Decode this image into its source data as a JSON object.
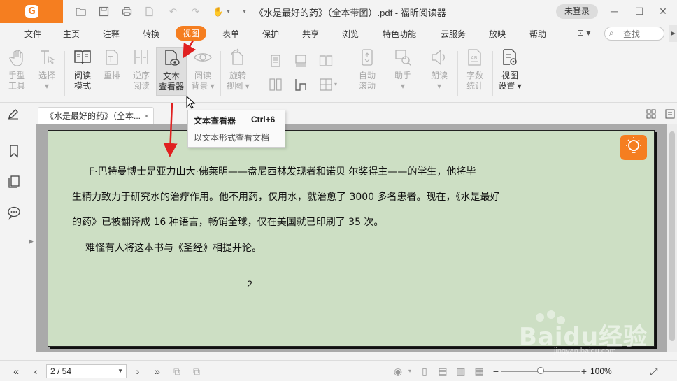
{
  "window": {
    "title": "《水是最好的药》（全本带图）.pdf - 福昕阅读器",
    "login_label": "未登录",
    "accent_color": "#f57e20"
  },
  "menu": {
    "items": [
      "文件",
      "主页",
      "注释",
      "转换",
      "视图",
      "表单",
      "保护",
      "共享",
      "浏览",
      "特色功能",
      "云服务",
      "放映",
      "帮助"
    ],
    "active": "视图",
    "search_placeholder": "查找"
  },
  "ribbon": {
    "tools": [
      {
        "line1": "手型",
        "line2": "工具",
        "state": "disabled",
        "icon": "hand-icon"
      },
      {
        "line1": "选择",
        "line2": "▾",
        "state": "disabled",
        "icon": "select-text-icon"
      },
      {
        "line1": "阅读",
        "line2": "模式",
        "state": "enabled",
        "icon": "book-icon"
      },
      {
        "line1": "重排",
        "line2": "",
        "state": "disabled",
        "icon": "reflow-icon"
      },
      {
        "line1": "逆序",
        "line2": "阅读",
        "state": "disabled",
        "icon": "reverse-icon"
      },
      {
        "line1": "文本",
        "line2": "查看器",
        "state": "selected",
        "icon": "text-viewer-icon"
      },
      {
        "line1": "阅读",
        "line2": "背景 ▾",
        "state": "disabled",
        "icon": "eye-icon"
      },
      {
        "line1": "旋转",
        "line2": "视图 ▾",
        "state": "disabled",
        "icon": "rotate-icon"
      },
      {
        "line1": "自动",
        "line2": "滚动",
        "state": "disabled",
        "icon": "auto-scroll-icon"
      },
      {
        "line1": "助手",
        "line2": "▾",
        "state": "disabled",
        "icon": "assistant-icon"
      },
      {
        "line1": "朗读",
        "line2": "▾",
        "state": "disabled",
        "icon": "speaker-icon"
      },
      {
        "line1": "字数",
        "line2": "统计",
        "state": "disabled",
        "icon": "word-count-icon"
      },
      {
        "line1": "视图",
        "line2": "设置 ▾",
        "state": "enabled",
        "icon": "view-settings-icon"
      }
    ]
  },
  "tab": {
    "title": "《水是最好的药》（全本...",
    "close": "×"
  },
  "tooltip": {
    "title": "文本查看器",
    "shortcut": "Ctrl+6",
    "description": "以文本形式查看文档"
  },
  "document": {
    "paragraphs": [
      "F·巴特曼博士是亚力山大·佛莱明——盘尼西林发现者和诺贝 尔奖得主——的学生，他将毕",
      "生精力致力于研究水的治疗作用。他不用药，仅用水，就治愈了 3000 多名患者。现在，《水是最好",
      "的药》已被翻译成 16 种语言，畅销全球，仅在美国就已印刷了 35 次。",
      "难怪有人将这本书与《圣经》相提并论。"
    ],
    "page_number": "2",
    "page_bg_color": "#cddfc4"
  },
  "status": {
    "page_indicator": "2 / 54",
    "zoom": "100%",
    "zoom_fraction": 0.5
  },
  "watermark": {
    "text": "Baidu经验",
    "url": "jingyan.baidu.com"
  }
}
